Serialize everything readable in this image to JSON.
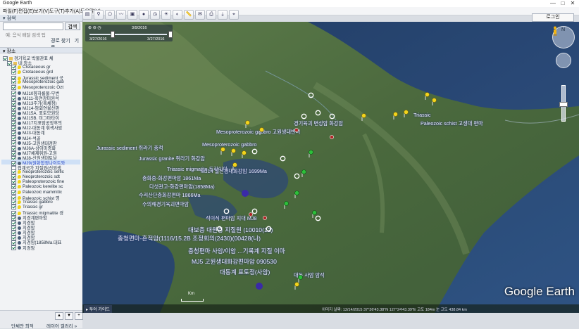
{
  "window": {
    "title": "Google Earth",
    "controls": [
      "—",
      "□",
      "✕"
    ]
  },
  "menubar": {
    "items": [
      "파일(F)",
      "편집(E)",
      "보기(V)",
      "도구(T)",
      "추가(A)",
      "도움말(H)"
    ]
  },
  "toolbar": {
    "login": "로그인"
  },
  "search": {
    "header": "검색",
    "placeholder": "",
    "button": "검색",
    "hint": "예: 음식 배달 검색 팁",
    "links": [
      "경로 찾기",
      "기록"
    ]
  },
  "places": {
    "header": "장소",
    "items": [
      {
        "label": "경기육교 박물관표 체",
        "checked": true,
        "icon": "folder"
      },
      {
        "label": "내 장소",
        "checked": true,
        "icon": "folder"
      },
      {
        "label": "Cretaceous gr",
        "checked": true,
        "icon": "pin"
      },
      {
        "label": "Cretaceous grd",
        "checked": true,
        "icon": "pin"
      },
      {
        "label": "Jurassic sediment 국",
        "checked": true,
        "icon": "pin"
      },
      {
        "label": "Mesoproterozoic gab",
        "checked": true,
        "icon": "pin"
      },
      {
        "label": "Mesoproterozoic Ozt",
        "checked": true,
        "icon": "pin"
      },
      {
        "label": "MJ10향하룡물-무번",
        "checked": true,
        "icon": "dot"
      },
      {
        "label": "MJ11-흑연광미원석",
        "checked": true,
        "icon": "dot"
      },
      {
        "label": "MJ13주가(혹체점)",
        "checked": true,
        "icon": "dot"
      },
      {
        "label": "MJ14-암회연울산판",
        "checked": true,
        "icon": "dot"
      },
      {
        "label": "MJ15A. 표토모원당",
        "checked": true,
        "icon": "dot"
      },
      {
        "label": "MJ15B. 미그마타이",
        "checked": true,
        "icon": "dot"
      },
      {
        "label": "MJ17지표암공장후의",
        "checked": true,
        "icon": "dot"
      },
      {
        "label": "MJ2-대동계 휘색사암",
        "checked": true,
        "icon": "dot"
      },
      {
        "label": "MJ3-대동계",
        "checked": true,
        "icon": "dot"
      },
      {
        "label": "MJ4-석골",
        "checked": true,
        "icon": "dot"
      },
      {
        "label": "MJ5-고원생대경판",
        "checked": true,
        "icon": "dot"
      },
      {
        "label": "MJ6A-상이미종화",
        "checked": true,
        "icon": "dot"
      },
      {
        "label": "MJ7체제휘원-고원",
        "checked": true,
        "icon": "dot"
      },
      {
        "label": "MJ8-신원생대토날",
        "checked": true,
        "icon": "dot"
      },
      {
        "label": "MJ9(원화함정나이트와",
        "checked": true,
        "icon": "dot",
        "selected": true
      },
      {
        "label": "접계국가 지질원(신원생",
        "checked": false,
        "icon": "none"
      },
      {
        "label": "Neoproterozoic selfic",
        "checked": true,
        "icon": "pin"
      },
      {
        "label": "Neoproterozoic sdt",
        "checked": true,
        "icon": "pin"
      },
      {
        "label": "Paleoproterozoic fine",
        "checked": true,
        "icon": "pin"
      },
      {
        "label": "Paleozoic kerelite sc",
        "checked": true,
        "icon": "pin"
      },
      {
        "label": "Paleozoic mammitic",
        "checked": true,
        "icon": "pin"
      },
      {
        "label": "Paleozoic schist 영",
        "checked": true,
        "icon": "pin"
      },
      {
        "label": "Triassic gabbro",
        "checked": true,
        "icon": "pin"
      },
      {
        "label": "Triassic gr",
        "checked": true,
        "icon": "pin"
      },
      {
        "label": "Triassic migmatite 경",
        "checked": true,
        "icon": "pin"
      },
      {
        "label": "지경계편마암",
        "checked": true,
        "icon": "dot"
      },
      {
        "label": "지경암",
        "checked": true,
        "icon": "dot"
      },
      {
        "label": "지경암",
        "checked": true,
        "icon": "dot"
      },
      {
        "label": "지경암",
        "checked": true,
        "icon": "dot"
      },
      {
        "label": "지경암",
        "checked": true,
        "icon": "dot"
      },
      {
        "label": "지경암(1858Ma.대표",
        "checked": true,
        "icon": "dot"
      },
      {
        "label": "지경암",
        "checked": true,
        "icon": "dot"
      }
    ]
  },
  "left_footer": {
    "db_label": "단체만 최적",
    "gallery": "레이어 갤러리 »"
  },
  "timeslider": {
    "start": "3/27/2016",
    "mid": "3/9/2016",
    "end": "3/27/2016"
  },
  "map": {
    "labels": [
      {
        "text": "Mesoproterozoic gabbro 고원생대반려",
        "big": false
      },
      {
        "text": "Mesoproterozoic gabbro",
        "big": false
      },
      {
        "text": "Jurassic sediment 쥐라기 충적",
        "big": false
      },
      {
        "text": "Jurassic granite 쥐라기 화강암",
        "big": false
      },
      {
        "text": "Triassic migmatite 트라이아",
        "big": false
      },
      {
        "text": "MJ14 일신경대화강암 1699Ma",
        "big": false
      },
      {
        "text": "충화중-화강편마암 1861Ma",
        "big": false
      },
      {
        "text": "다섯관고-화강편마암(1858Ma)",
        "big": false
      },
      {
        "text": "수리산단층화강편마 1866Ma",
        "big": false
      },
      {
        "text": "수의해경기육괴편마암",
        "big": false
      },
      {
        "text": "석이식 편마암 지대 MJ8",
        "big": false
      },
      {
        "text": "대보층 대원층 지질원 (10010(12)",
        "big": true
      },
      {
        "text": "충청편마-흔적암(1116/15.2B 조정회의(2430)(00428(나)",
        "big": true
      },
      {
        "text": "충청편마 사암/이암 ...기록계 지질 이마",
        "big": true
      },
      {
        "text": "MJ5 고원생대화강편마암 090530",
        "big": true
      },
      {
        "text": "대동계 표토정(사암)",
        "big": true
      },
      {
        "text": "대동 사암 암석",
        "big": false
      },
      {
        "text": "Triassic",
        "big": false
      },
      {
        "text": "Paleozoic schist 고생대 편마",
        "big": false
      },
      {
        "text": "경기육괴 변성암 화강암",
        "big": false
      }
    ],
    "brand": "Google Earth",
    "scale": "Km",
    "tour_label": "투어 가이드",
    "status": "이미지 날짜: 12/14/2015   37°36'43.38\"N 127°24'43.39\"E  고도 184m   눈 고도 438.84 km",
    "compass_north": "N"
  },
  "colors": {
    "sea": "#1c3b66",
    "land": "#4f6b3c",
    "pin": "#f2d41c",
    "green_pin": "#2dbf3a",
    "purple": "#3a2aa8"
  }
}
